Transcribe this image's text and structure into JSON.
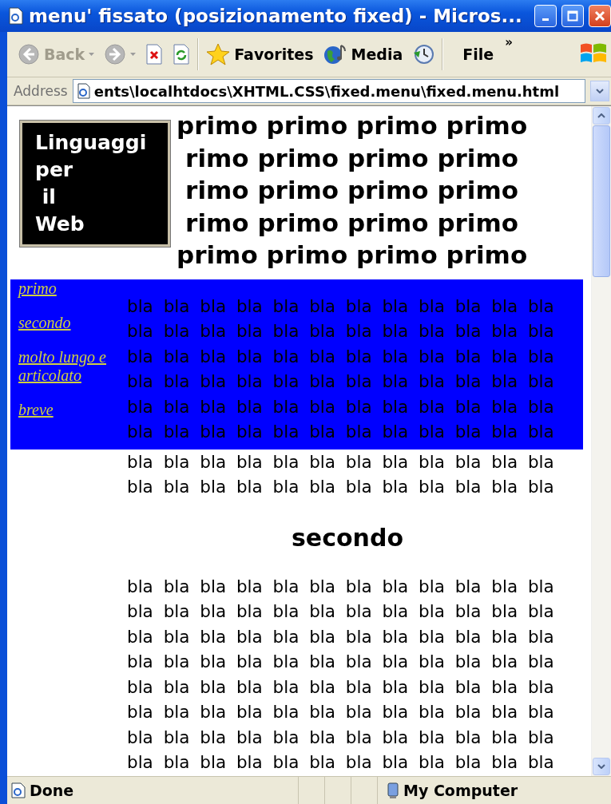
{
  "window": {
    "title": "menu' fissato (posizionamento fixed) - Micros..."
  },
  "toolbar": {
    "buttons": [
      {
        "kind": "back",
        "label": "Back",
        "disabled": true
      },
      {
        "kind": "forward",
        "disabled": true
      },
      {
        "kind": "stop",
        "disabled": false
      },
      {
        "kind": "refresh",
        "disabled": false
      },
      {
        "kind": "favorites",
        "label": "Favorites",
        "disabled": false
      },
      {
        "kind": "media",
        "label": "Media",
        "disabled": false
      },
      {
        "kind": "history",
        "disabled": false
      }
    ],
    "menu": "File",
    "overflow": "»"
  },
  "address": {
    "label": "Address",
    "value": "ents\\localhtdocs\\XHTML.CSS\\fixed.menu\\fixed.menu.html"
  },
  "page": {
    "logo": "Linguaggi\nper\n il\nWeb",
    "heading_lines": [
      "primo primo primo primo",
      "rimo primo primo primo",
      "rimo primo primo primo",
      "rimo primo primo primo",
      "primo primo primo primo"
    ],
    "menu": [
      "primo",
      "secondo",
      "molto lungo e articolato",
      "breve"
    ],
    "section_1_lines": [
      "bla bla bla bla bla bla bla bla bla bla bla bla",
      "bla bla bla bla bla bla bla bla bla bla bla bla",
      "bla bla bla bla bla bla bla bla bla bla bla bla",
      "bla bla bla bla bla bla bla bla bla bla bla bla",
      "bla bla bla bla bla bla bla bla bla bla bla bla",
      "bla bla bla bla bla bla bla bla bla bla bla bla",
      "bla bla bla bla bla bla bla bla bla bla bla bla",
      "bla bla bla bla bla bla bla bla bla bla bla bla"
    ],
    "section_2_heading": "secondo",
    "section_2_lines": [
      "bla bla bla bla bla bla bla bla bla bla bla bla",
      "bla bla bla bla bla bla bla bla bla bla bla bla",
      "bla bla bla bla bla bla bla bla bla bla bla bla",
      "bla bla bla bla bla bla bla bla bla bla bla bla",
      "bla bla bla bla bla bla bla bla bla bla bla bla",
      "bla bla bla bla bla bla bla bla bla bla bla bla",
      "bla bla bla bla bla bla bla bla bla bla bla bla",
      "bla bla bla bla bla bla bla bla bla bla bla bla"
    ]
  },
  "status_bar": {
    "text": "Done",
    "zone": "My Computer"
  }
}
